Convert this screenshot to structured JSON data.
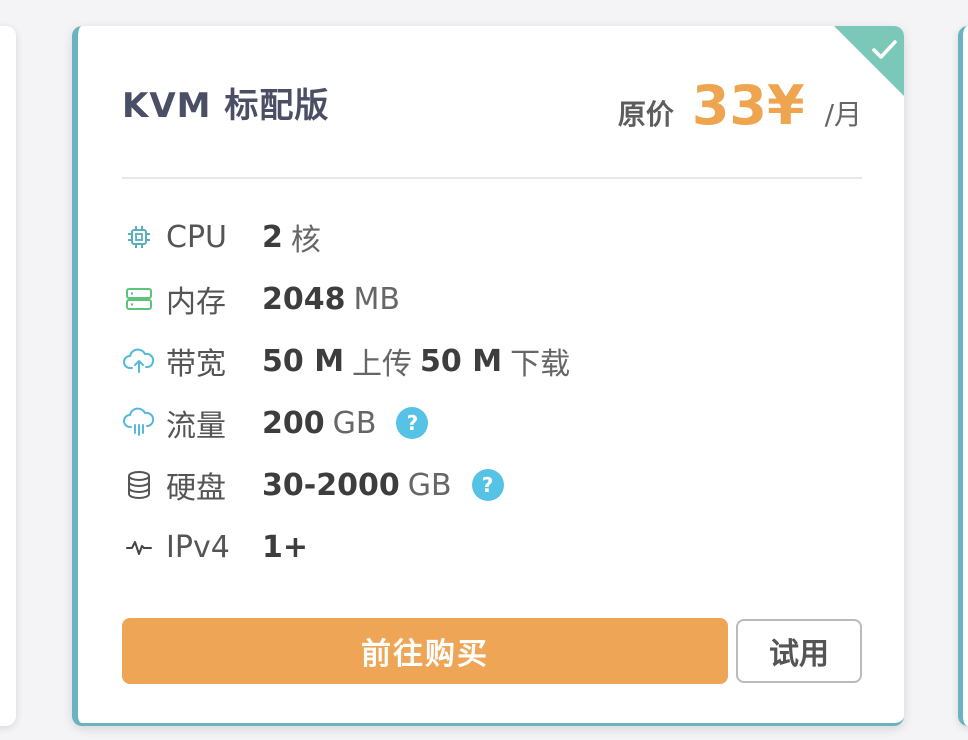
{
  "card": {
    "title": "KVM 标配版",
    "price_label": "原价",
    "price_value": "33¥",
    "price_unit": "/月",
    "accent_color": "#6bb3c0",
    "price_color": "#efa54f"
  },
  "specs": [
    {
      "icon": "cpu-icon",
      "label": "CPU",
      "value": "2",
      "unit": "核"
    },
    {
      "icon": "memory-icon",
      "label": "内存",
      "value": "2048",
      "unit": "MB"
    },
    {
      "icon": "cloud-upload-icon",
      "label": "带宽",
      "value": "50 M",
      "unit": "上传",
      "value2": "50 M",
      "unit2": "下载"
    },
    {
      "icon": "cloud-rain-icon",
      "label": "流量",
      "value": "200",
      "unit": "GB",
      "help": "?"
    },
    {
      "icon": "database-icon",
      "label": "硬盘",
      "value": "30-2000",
      "unit": "GB",
      "help": "?"
    },
    {
      "icon": "pulse-icon",
      "label": "IPv4",
      "value": "1+"
    }
  ],
  "actions": {
    "buy_label": "前往购买",
    "try_label": "试用",
    "buy_color": "#efa556"
  }
}
